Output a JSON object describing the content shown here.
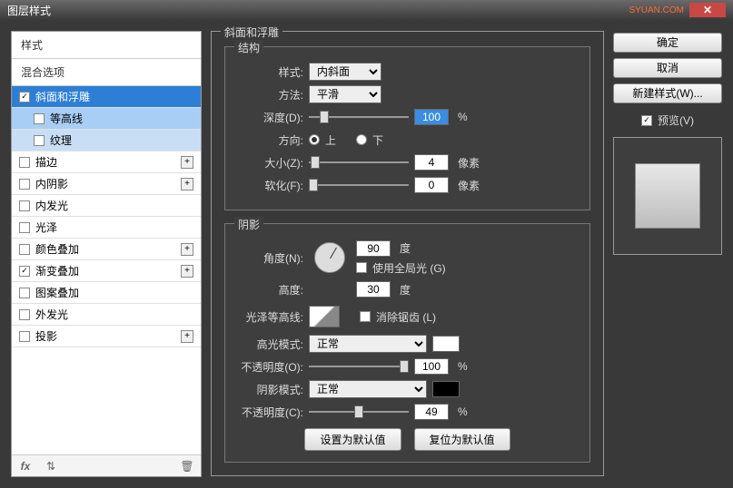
{
  "title": "图层样式",
  "watermark": "SYUAN.COM",
  "left": {
    "header": "样式",
    "sub": "混合选项",
    "items": [
      {
        "label": "斜面和浮雕",
        "checked": true,
        "sel": true,
        "sub": false,
        "plus": false
      },
      {
        "label": "等高线",
        "checked": false,
        "sel": false,
        "sub": true,
        "plus": false
      },
      {
        "label": "纹理",
        "checked": false,
        "sel": false,
        "sub": true,
        "plus": false,
        "cls": "sub2"
      },
      {
        "label": "描边",
        "checked": false,
        "sel": false,
        "sub": false,
        "plus": true
      },
      {
        "label": "内阴影",
        "checked": false,
        "sel": false,
        "sub": false,
        "plus": true
      },
      {
        "label": "内发光",
        "checked": false,
        "sel": false,
        "sub": false,
        "plus": false
      },
      {
        "label": "光泽",
        "checked": false,
        "sel": false,
        "sub": false,
        "plus": false
      },
      {
        "label": "颜色叠加",
        "checked": false,
        "sel": false,
        "sub": false,
        "plus": true
      },
      {
        "label": "渐变叠加",
        "checked": true,
        "sel": false,
        "sub": false,
        "plus": true
      },
      {
        "label": "图案叠加",
        "checked": false,
        "sel": false,
        "sub": false,
        "plus": false
      },
      {
        "label": "外发光",
        "checked": false,
        "sel": false,
        "sub": false,
        "plus": false
      },
      {
        "label": "投影",
        "checked": false,
        "sel": false,
        "sub": false,
        "plus": true
      }
    ],
    "footer_fx": "fx"
  },
  "center": {
    "main_legend": "斜面和浮雕",
    "struct_legend": "结构",
    "style_label": "样式:",
    "style_val": "内斜面",
    "method_label": "方法:",
    "method_val": "平滑",
    "depth_label": "深度(D):",
    "depth_val": "100",
    "depth_unit": "%",
    "dir_label": "方向:",
    "dir_up": "上",
    "dir_down": "下",
    "size_label": "大小(Z):",
    "size_val": "4",
    "size_unit": "像素",
    "soften_label": "软化(F):",
    "soften_val": "0",
    "soften_unit": "像素",
    "shadow_legend": "阴影",
    "angle_label": "角度(N):",
    "angle_val": "90",
    "angle_unit": "度",
    "global_label": "使用全局光 (G)",
    "alt_label": "高度:",
    "alt_val": "30",
    "alt_unit": "度",
    "gloss_label": "光泽等高线:",
    "antialias_label": "消除锯齿 (L)",
    "hilite_label": "高光模式:",
    "hilite_val": "正常",
    "opac1_label": "不透明度(O):",
    "opac1_val": "100",
    "opac1_unit": "%",
    "shadow_label": "阴影模式:",
    "shadow_val": "正常",
    "opac2_label": "不透明度(C):",
    "opac2_val": "49",
    "opac2_unit": "%",
    "btn_default": "设置为默认值",
    "btn_reset": "复位为默认值"
  },
  "right": {
    "ok": "确定",
    "cancel": "取消",
    "newstyle": "新建样式(W)...",
    "preview": "预览(V)"
  }
}
